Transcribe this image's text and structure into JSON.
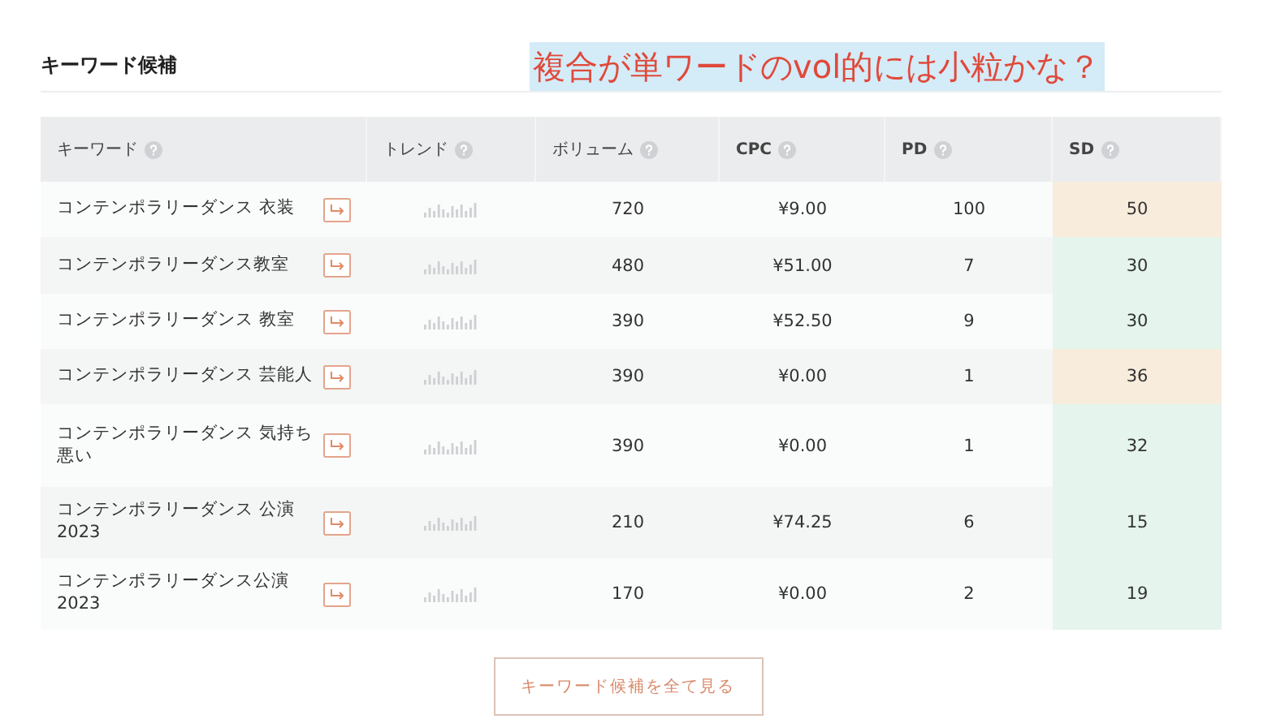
{
  "section_title": "キーワード候補",
  "annotation": "複合が単ワードのvol的には小粒かな？",
  "table": {
    "columns": [
      {
        "label": "キーワード",
        "bold": false
      },
      {
        "label": "トレンド",
        "bold": false
      },
      {
        "label": "ボリューム",
        "bold": false
      },
      {
        "label": "CPC",
        "bold": true
      },
      {
        "label": "PD",
        "bold": true
      },
      {
        "label": "SD",
        "bold": true
      }
    ],
    "rows": [
      {
        "keyword": "コンテンポラリーダンス 衣装",
        "volume": "720",
        "cpc": "¥9.00",
        "pd": "100",
        "sd": "50",
        "color": "#f8ecdc"
      },
      {
        "keyword": "コンテンポラリーダンス教室",
        "volume": "480",
        "cpc": "¥51.00",
        "pd": "7",
        "sd": "30",
        "color": "#e5f4ec"
      },
      {
        "keyword": "コンテンポラリーダンス 教室",
        "volume": "390",
        "cpc": "¥52.50",
        "pd": "9",
        "sd": "30",
        "color": "#e5f4ec"
      },
      {
        "keyword": "コンテンポラリーダンス 芸能人",
        "volume": "390",
        "cpc": "¥0.00",
        "pd": "1",
        "sd": "36",
        "color": "#f8ecdc"
      },
      {
        "keyword": "コンテンポラリーダンス 気持ち悪い",
        "volume": "390",
        "cpc": "¥0.00",
        "pd": "1",
        "sd": "32",
        "color": "#e5f4ec"
      },
      {
        "keyword": "コンテンポラリーダンス 公演2023",
        "volume": "210",
        "cpc": "¥74.25",
        "pd": "6",
        "sd": "15",
        "color": "#e5f4ec"
      },
      {
        "keyword": "コンテンポラリーダンス公演2023",
        "volume": "170",
        "cpc": "¥0.00",
        "pd": "2",
        "sd": "19",
        "color": "#e5f4ec"
      }
    ]
  },
  "view_all_button": "キーワード候補を全て見る"
}
